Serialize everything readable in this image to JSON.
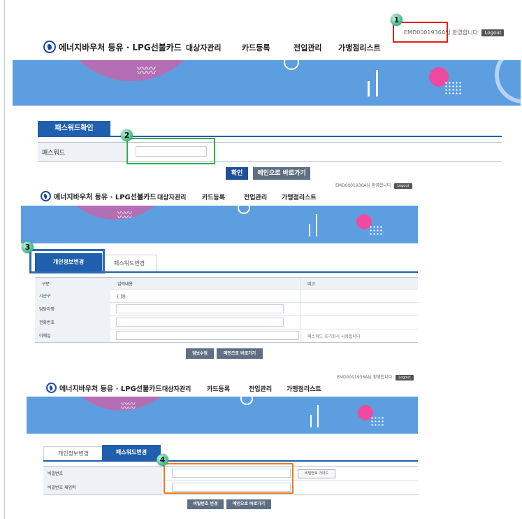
{
  "header": {
    "user_text": "EMD0001936A님 환영합니다",
    "logout_label": "Logout",
    "logo_text": "에너지바우처 등유 · LPG선불카드",
    "nav": [
      "대상자관리",
      "카드등록",
      "전입관리",
      "가맹점리스트"
    ]
  },
  "section1": {
    "tab_label": "패스워드확인",
    "password_label": "패스워드",
    "password_value": "",
    "confirm_button": "확인",
    "main_button": "메인으로 바로가기"
  },
  "section2": {
    "tabs": [
      "개인정보변경",
      "패스워드변경"
    ],
    "table_headers": [
      "구분",
      "입력내용",
      "비고"
    ],
    "rows": [
      {
        "label": "시군구",
        "value": "[                     ]동",
        "note": ""
      },
      {
        "label": "담당자명",
        "value": "",
        "note": ""
      },
      {
        "label": "전화번호",
        "value": "",
        "note": ""
      },
      {
        "label": "이메일",
        "value": "",
        "note": "패스워드 초기화시 사용됩니다"
      }
    ],
    "save_button": "정보수정",
    "main_button": "메인으로 바로가기"
  },
  "section3": {
    "tabs": [
      "개인정보변경",
      "패스워드변경"
    ],
    "password_label": "비밀번호",
    "password_confirm_label": "비밀번호 재입력",
    "guide_button": "비밀번호 가이드",
    "change_button": "비밀번호 변경",
    "main_button": "메인으로 바로가기"
  },
  "annotations": {
    "numbers": [
      "1",
      "2",
      "3",
      "4"
    ],
    "colors": {
      "red": "#e0201c",
      "green": "#2fb04a",
      "blue": "#2a6bb5",
      "orange": "#ec7a1c"
    }
  },
  "colors": {
    "banner": "#5d9ee0",
    "accent": "#1f5fad"
  }
}
